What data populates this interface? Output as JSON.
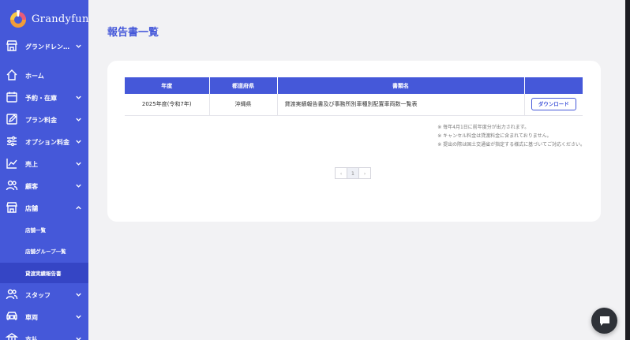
{
  "brand": {
    "name": "Grandyfun"
  },
  "sidebar": {
    "items": [
      {
        "label": "グランドレン…",
        "icon": "store-icon",
        "expandable": true
      },
      {
        "label": "ホーム",
        "icon": "home-icon",
        "expandable": false
      },
      {
        "label": "予約・在庫",
        "icon": "calendar-icon",
        "expandable": true
      },
      {
        "label": "プラン料金",
        "icon": "edit-icon",
        "expandable": true
      },
      {
        "label": "オプション料金",
        "icon": "sliders-icon",
        "expandable": true
      },
      {
        "label": "売上",
        "icon": "chart-icon",
        "expandable": true
      },
      {
        "label": "顧客",
        "icon": "users-icon",
        "expandable": true
      },
      {
        "label": "店舗",
        "icon": "store-icon",
        "expandable": true,
        "expanded": true
      },
      {
        "label": "スタッフ",
        "icon": "users-icon",
        "expandable": true
      },
      {
        "label": "車両",
        "icon": "car-icon",
        "expandable": true
      },
      {
        "label": "支払",
        "icon": "bank-icon",
        "expandable": true
      }
    ],
    "sub_items": [
      {
        "label": "店舗一覧"
      },
      {
        "label": "店舗グループ一覧"
      },
      {
        "label": "貸渡実績報告書",
        "active": true
      }
    ]
  },
  "page": {
    "title": "報告書一覧"
  },
  "table": {
    "headers": [
      "年度",
      "都道府県",
      "書類名",
      ""
    ],
    "rows": [
      {
        "year": "2025年度(令和7年)",
        "prefecture": "沖縄県",
        "document": "貸渡実績報告書及び事務所別車種別配置車両数一覧表",
        "action": "ダウンロード"
      }
    ]
  },
  "notes": [
    "※ 毎年4月1日に前年度分が出力されます。",
    "※ キャンセル料金は貸渡料金に含まれておりません。",
    "※ 提出の際は国土交通省が指定する様式に基づいてご対応ください。"
  ],
  "pagination": {
    "prev": "‹",
    "current": "1",
    "next": "›"
  },
  "colors": {
    "primary": "#4558d9",
    "active": "#3545c5",
    "background": "#f2f2f4"
  }
}
